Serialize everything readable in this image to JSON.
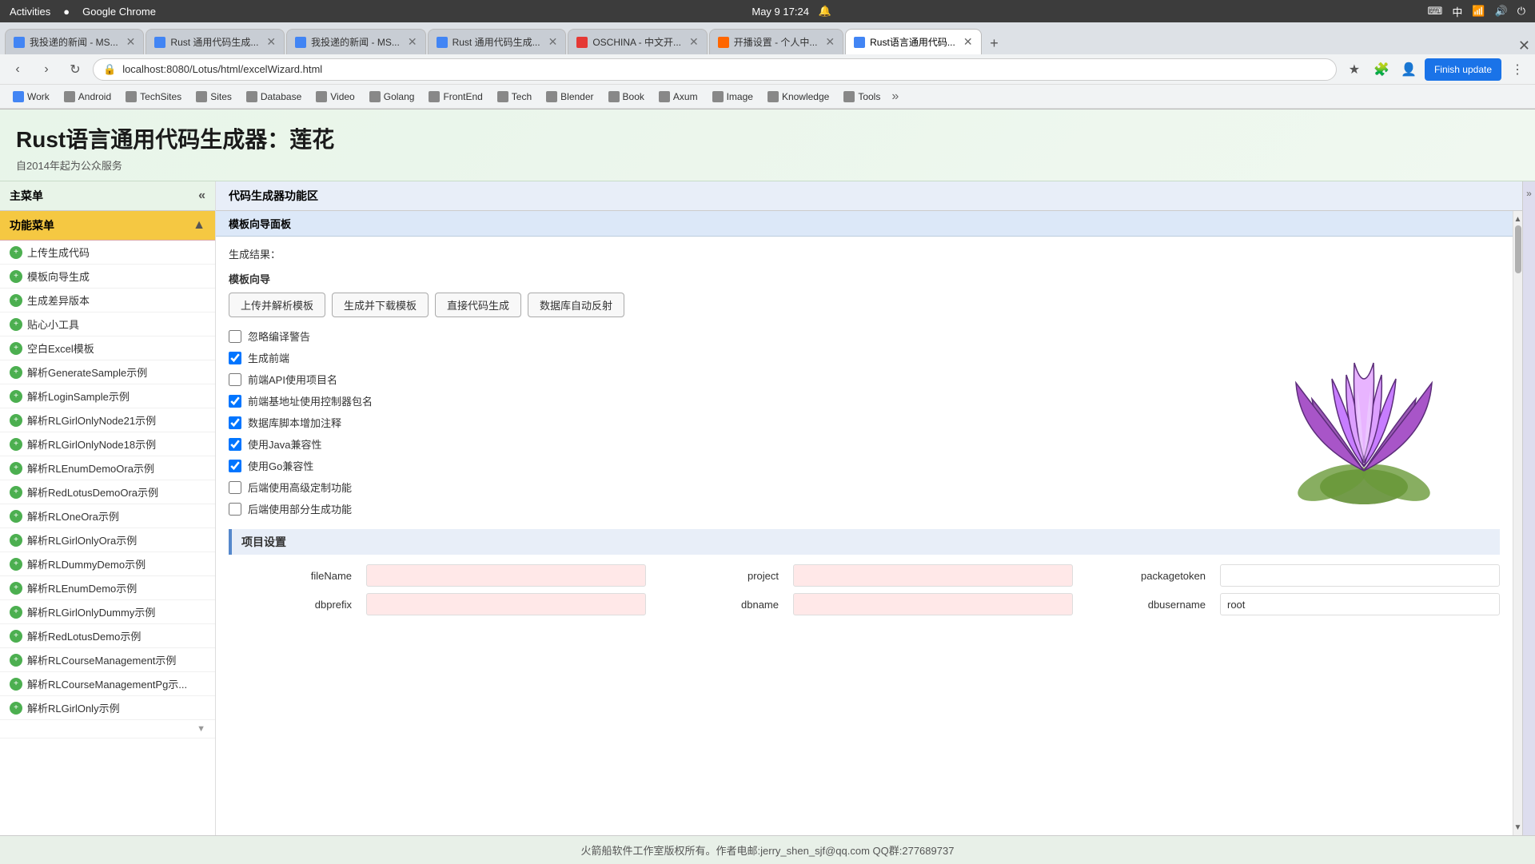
{
  "os_bar": {
    "activities": "Activities",
    "app_name": "Google Chrome",
    "datetime": "May 9  17:24",
    "mute_icon": "🔔"
  },
  "browser": {
    "tabs": [
      {
        "label": "我投递的新闻 - MS...",
        "active": false,
        "favicon_color": "#4285f4"
      },
      {
        "label": "Rust 通用代码生成...",
        "active": false,
        "favicon_color": "#4285f4"
      },
      {
        "label": "我投递的新闻 - MS...",
        "active": false,
        "favicon_color": "#4285f4"
      },
      {
        "label": "Rust 通用代码生成...",
        "active": false,
        "favicon_color": "#4285f4"
      },
      {
        "label": "OSCHINA - 中文开...",
        "active": false,
        "favicon_color": "#e53935"
      },
      {
        "label": "开播设置 - 个人中...",
        "active": false,
        "favicon_color": "#ff6600"
      },
      {
        "label": "Rust语言通用代码...",
        "active": true,
        "favicon_color": "#4285f4"
      }
    ],
    "url": "localhost:8080/Lotus/html/excelWizard.html",
    "finish_update": "Finish update"
  },
  "bookmarks": [
    {
      "label": "Work"
    },
    {
      "label": "Android"
    },
    {
      "label": "TechSites"
    },
    {
      "label": "Sites"
    },
    {
      "label": "Database"
    },
    {
      "label": "Video"
    },
    {
      "label": "Golang"
    },
    {
      "label": "FrontEnd"
    },
    {
      "label": "Tech"
    },
    {
      "label": "Blender"
    },
    {
      "label": "Book"
    },
    {
      "label": "Axum"
    },
    {
      "label": "Image"
    },
    {
      "label": "Knowledge"
    },
    {
      "label": "Tools"
    }
  ],
  "page": {
    "title": "Rust语言通用代码生成器：莲花",
    "subtitle": "自2014年起为公众服务"
  },
  "sidebar": {
    "main_menu_label": "主菜单",
    "func_menu_label": "功能菜单",
    "items": [
      {
        "label": "上传生成代码"
      },
      {
        "label": "模板向导生成"
      },
      {
        "label": "生成差异版本"
      },
      {
        "label": "贴心小工具"
      },
      {
        "label": "空白Excel模板"
      },
      {
        "label": "解析GenerateSample示例"
      },
      {
        "label": "解析LoginSample示例"
      },
      {
        "label": "解析RLGirlOnlyNode21示例"
      },
      {
        "label": "解析RLGirlOnlyNode18示例"
      },
      {
        "label": "解析RLEnumDemoOra示例"
      },
      {
        "label": "解析RedLotusDemoOra示例"
      },
      {
        "label": "解析RLOneOra示例"
      },
      {
        "label": "解析RLGirlOnlyOra示例"
      },
      {
        "label": "解析RLDummyDemo示例"
      },
      {
        "label": "解析RLEnumDemo示例"
      },
      {
        "label": "解析RLGirlOnlyDummy示例"
      },
      {
        "label": "解析RedLotusDemo示例"
      },
      {
        "label": "解析RLCourseManagement示例"
      },
      {
        "label": "解析RLCourseManagementPg示..."
      },
      {
        "label": "解析RLGirlOnly示例"
      }
    ]
  },
  "content": {
    "area_label": "代码生成器功能区",
    "panel_label": "模板向导面板",
    "generate_result_label": "生成结果：",
    "template_wizard_label": "模板向导",
    "buttons": [
      {
        "label": "上传并解析模板"
      },
      {
        "label": "生成并下载模板"
      },
      {
        "label": "直接代码生成"
      },
      {
        "label": "数据库自动反射"
      }
    ],
    "checkboxes": [
      {
        "label": "忽略编译警告",
        "checked": false
      },
      {
        "label": "生成前端",
        "checked": true
      },
      {
        "label": "前端API使用项目名",
        "checked": false
      },
      {
        "label": "前端基地址使用控制器包名",
        "checked": true
      },
      {
        "label": "数据库脚本增加注释",
        "checked": true
      },
      {
        "label": "使用Java兼容性",
        "checked": true
      },
      {
        "label": "使用Go兼容性",
        "checked": true
      },
      {
        "label": "后端使用高级定制功能",
        "checked": false
      },
      {
        "label": "后端使用部分生成功能",
        "checked": false
      }
    ],
    "project_settings_label": "项目设置",
    "settings": [
      {
        "label": "fileName",
        "value": "",
        "pink": true
      },
      {
        "label": "project",
        "value": "",
        "pink": true
      },
      {
        "label": "packagetoken",
        "value": "",
        "pink": true
      },
      {
        "label": "dbprefix",
        "value": "",
        "pink": true
      },
      {
        "label": "dbname",
        "value": "",
        "pink": true
      },
      {
        "label": "dbusername",
        "value": "root",
        "pink": false
      }
    ]
  },
  "footer": {
    "text": "火箭船软件工作室版权所有。作者电邮:jerry_shen_sjf@qq.com QQ群:277689737"
  }
}
